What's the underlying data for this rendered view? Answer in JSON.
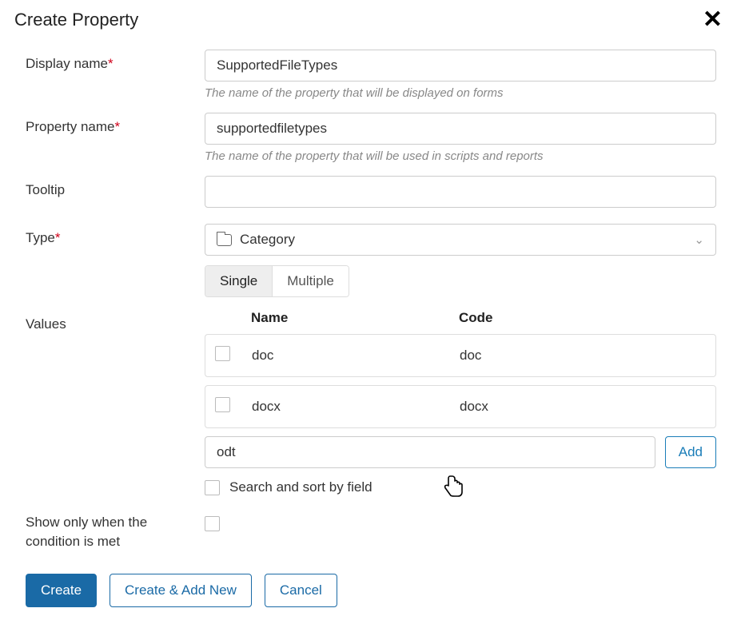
{
  "dialog": {
    "title": "Create Property"
  },
  "form": {
    "display_name": {
      "label": "Display name",
      "value": "SupportedFileTypes",
      "helper": "The name of the property that will be displayed on forms"
    },
    "property_name": {
      "label": "Property name",
      "value": "supportedfiletypes",
      "helper": "The name of the property that will be used in scripts and reports"
    },
    "tooltip": {
      "label": "Tooltip",
      "value": ""
    },
    "type": {
      "label": "Type",
      "value": "Category",
      "toggle_single": "Single",
      "toggle_multiple": "Multiple"
    },
    "values": {
      "label": "Values",
      "header_name": "Name",
      "header_code": "Code",
      "rows": [
        {
          "name": "doc",
          "code": "doc"
        },
        {
          "name": "docx",
          "code": "docx"
        }
      ],
      "new_value": "odt",
      "add_btn": "Add",
      "search_sort": "Search and sort by field"
    },
    "condition": {
      "label": "Show only when the condition is met"
    }
  },
  "footer": {
    "create": "Create",
    "create_add_new": "Create & Add New",
    "cancel": "Cancel"
  }
}
